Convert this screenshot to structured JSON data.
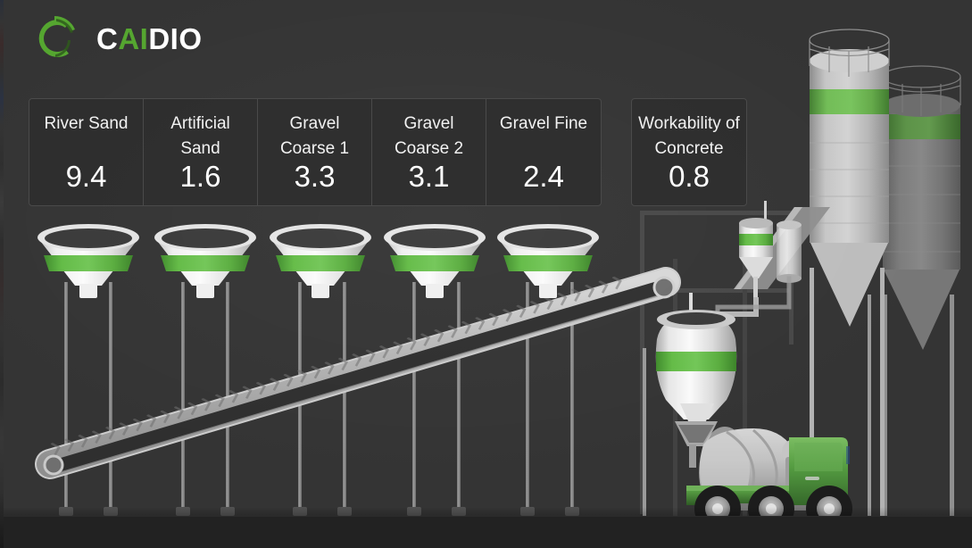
{
  "brand": {
    "logo_icon": "caidio-c-mark-icon",
    "name_part_1": "C",
    "name_part_2": "AI",
    "name_part_3": "DIO",
    "green": "#55a630",
    "white": "#ffffff"
  },
  "theme": {
    "background": "#343434",
    "ground": "#222222",
    "card_background": "#2d2d2d",
    "card_border": "#4a4a4a",
    "accent_green": "#5cb444",
    "metal_light": "#e8e8e8",
    "metal_mid": "#b4b4b4",
    "metal_dark": "#6e6e6e",
    "truck_green": "#4f9440"
  },
  "cards": {
    "aggregates": [
      {
        "label": "River Sand",
        "value": "9.4",
        "hopper": "funnel-river-sand"
      },
      {
        "label": "Artificial Sand",
        "value": "1.6",
        "hopper": "funnel-artificial-sand"
      },
      {
        "label": "Gravel Coarse 1",
        "value": "3.3",
        "hopper": "funnel-gravel-coarse-1"
      },
      {
        "label": "Gravel Coarse 2",
        "value": "3.1",
        "hopper": "funnel-gravel-coarse-2"
      },
      {
        "label": "Gravel Fine",
        "value": "2.4",
        "hopper": "funnel-gravel-fine"
      }
    ],
    "workability": {
      "label": "Workability of Concrete",
      "value": "0.8"
    }
  },
  "scene": {
    "title": "concrete batching plant schematic",
    "elements": [
      {
        "name": "aggregate-funnel",
        "count": 5,
        "accent": "green-band"
      },
      {
        "name": "conveyor-belt",
        "count": 1,
        "detail": "inclined chevron belt"
      },
      {
        "name": "cement-silo",
        "count": 2,
        "detail": "with top railing and cone bottom"
      },
      {
        "name": "cement-weigh-hopper",
        "count": 1,
        "accent": "green-band"
      },
      {
        "name": "cement-cylinder",
        "count": 1
      },
      {
        "name": "mixer-vessel",
        "count": 1,
        "accent": "green-band"
      },
      {
        "name": "mixer-truck",
        "count": 1,
        "detail": "green cab, gray drum, three axles"
      },
      {
        "name": "support-column",
        "count": 11
      }
    ]
  }
}
